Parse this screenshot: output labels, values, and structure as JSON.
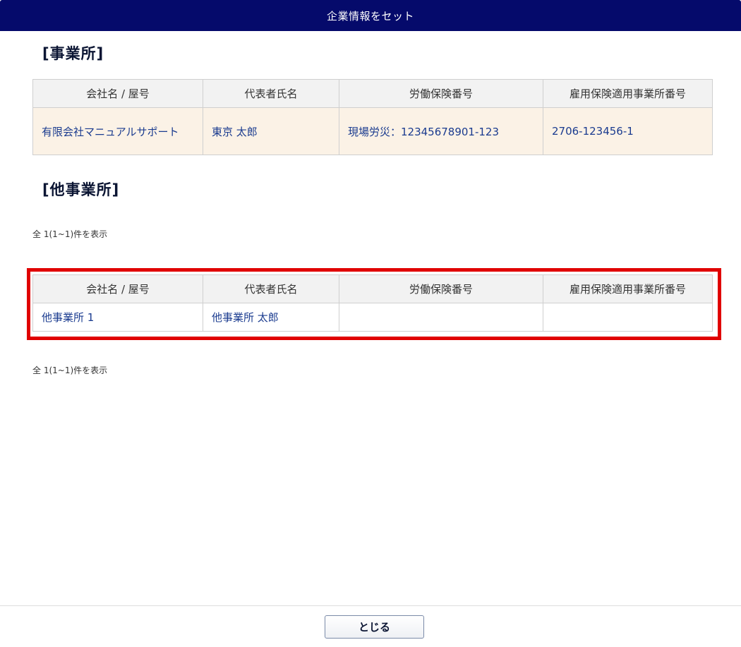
{
  "dialog": {
    "title": "企業情報をセット"
  },
  "offices": {
    "heading": "[事業所]",
    "columns": [
      "会社名 / 屋号",
      "代表者氏名",
      "労働保険番号",
      "雇用保険適用事業所番号"
    ],
    "rows": [
      {
        "company": "有限会社マニュアルサポート",
        "representative": "東京 太郎",
        "labor_insurance_no": "現場労災：12345678901-123",
        "employment_insurance_no": "2706-123456-1"
      }
    ]
  },
  "other_offices": {
    "heading": "[他事業所]",
    "count_text_top": "全 1(1~1)件を表示",
    "columns": [
      "会社名 / 屋号",
      "代表者氏名",
      "労働保険番号",
      "雇用保険適用事業所番号"
    ],
    "rows": [
      {
        "company": "他事業所 1",
        "representative": "他事業所 太郎",
        "labor_insurance_no": "",
        "employment_insurance_no": ""
      }
    ],
    "count_text_bottom": "全 1(1~1)件を表示"
  },
  "footer": {
    "close_label": "とじる"
  },
  "colors": {
    "titlebar": "#050a6b",
    "highlight": "#e00000",
    "row_bg": "#fbf2e6",
    "link": "#1a3b8f"
  }
}
